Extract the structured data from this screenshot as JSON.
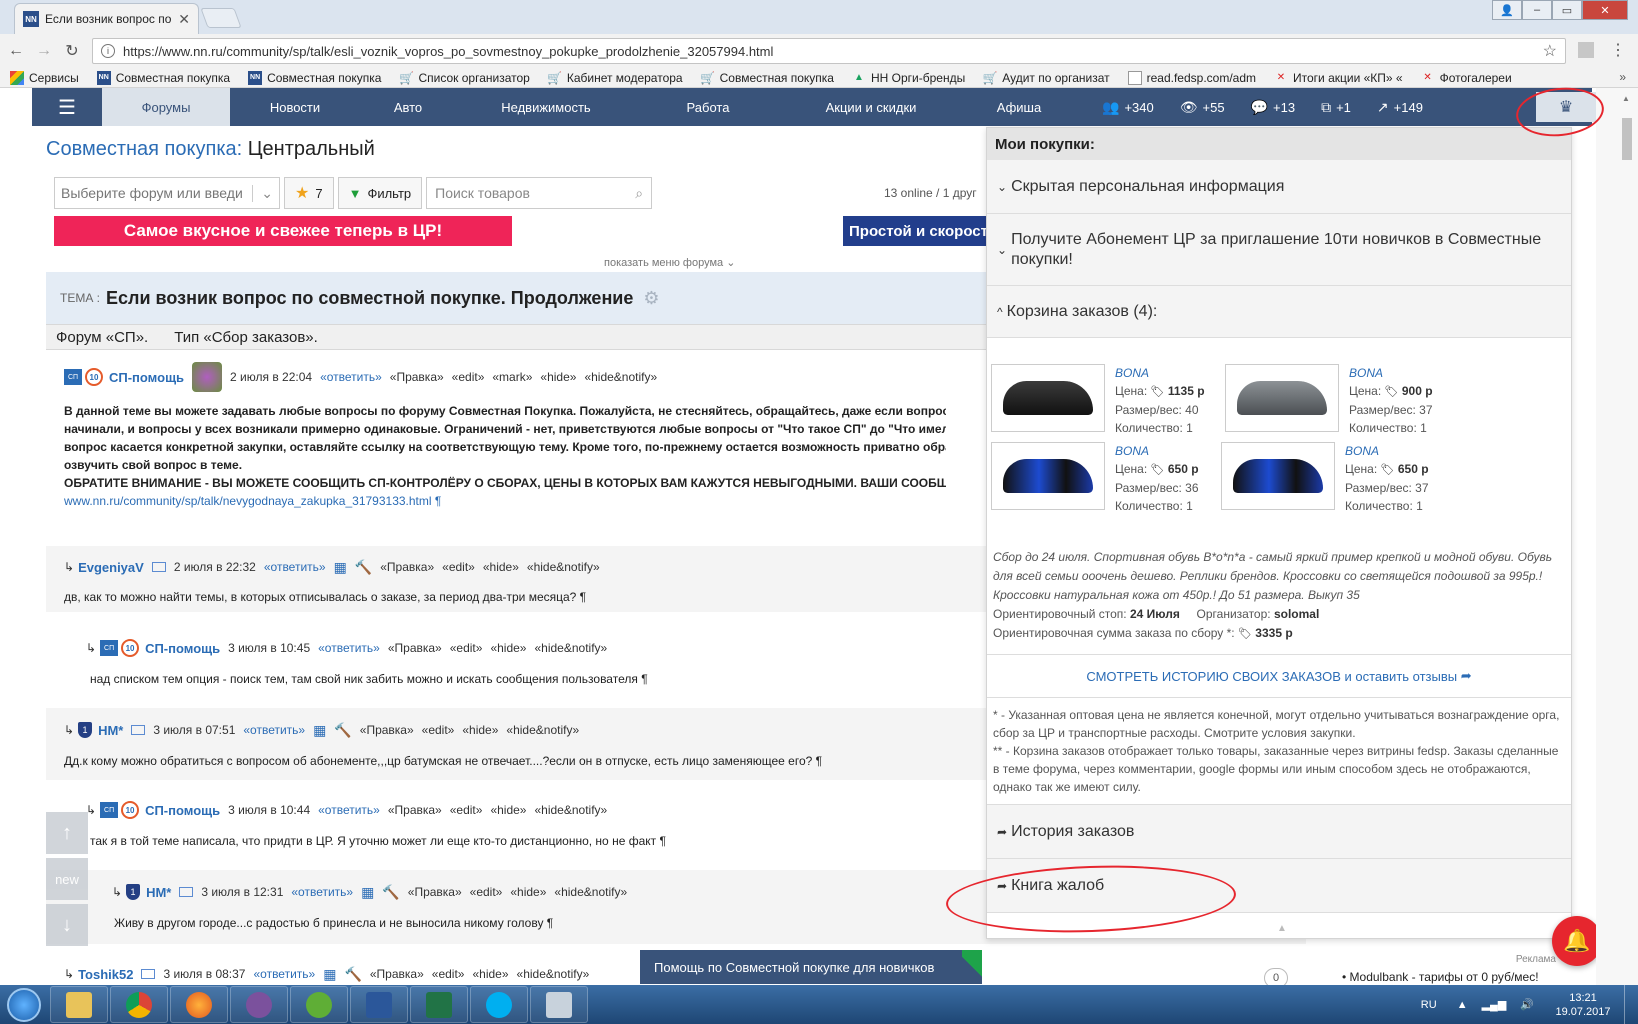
{
  "browser": {
    "tab_title": "Если возник вопрос по",
    "url": "https://www.nn.ru/community/sp/talk/esli_voznik_vopros_po_sovmestnoy_pokupke_prodolzhenie_32057994.html",
    "bookmarks": [
      {
        "label": "Сервисы",
        "icon": "apps"
      },
      {
        "label": "Совместная покупка",
        "icon": "nn"
      },
      {
        "label": "Совместная покупка",
        "icon": "nn"
      },
      {
        "label": "Список организатор",
        "icon": "cart"
      },
      {
        "label": "Кабинет модератора",
        "icon": "cart"
      },
      {
        "label": "Совместная покупка",
        "icon": "cart"
      },
      {
        "label": "НН Орги-бренды",
        "icon": "drive"
      },
      {
        "label": "Аудит по организат",
        "icon": "cart"
      },
      {
        "label": "read.fedsp.com/adm",
        "icon": "doc"
      },
      {
        "label": "Итоги акции «КП» «",
        "icon": "kp"
      },
      {
        "label": "Фотогалереи",
        "icon": "kp"
      }
    ]
  },
  "nav": {
    "items": [
      "Форумы",
      "Новости",
      "Авто",
      "Недвижимость",
      "Работа",
      "Акции и скидки",
      "Афиша"
    ],
    "stats": [
      {
        "icon": "users-icon",
        "glyph": "👥",
        "value": "+340"
      },
      {
        "icon": "eye-icon",
        "glyph": "👁",
        "value": "+55"
      },
      {
        "icon": "comment-icon",
        "glyph": "💬",
        "value": "+13"
      },
      {
        "icon": "windows-icon",
        "glyph": "⧉",
        "value": "+1"
      },
      {
        "icon": "rise-icon",
        "glyph": "↗",
        "value": "+149"
      }
    ]
  },
  "main": {
    "title_link": "Совместная покупка:",
    "title_rest": " Центральный",
    "forum_select_placeholder": "Выберите форум или введи",
    "fav_count": "7",
    "filter_label": "Фильтр",
    "search_placeholder": "Поиск товаров",
    "online": "13 online / 1 друг",
    "banner1": "Самое вкусное и свежее теперь в ЦР!",
    "banner2": "Простой и скоростной",
    "show_menu": "показать меню форума",
    "theme_label": "ТЕМА :",
    "theme_title": "Если возник вопрос по совместной покупке. Продолжение",
    "forum_name": "Форум «СП».",
    "forum_type": "Тип «Сбор заказов».",
    "help_bar": "Помощь по Совместной покупке для новичков",
    "side_new": "new",
    "zero": "0",
    "ad_label": "Реклама",
    "ad_text": "• Modulbank - тарифы от 0 руб/мес!"
  },
  "common": {
    "reply": "«ответить»",
    "edit_ru": "«Правка»",
    "edit": "«edit»",
    "mark": "«mark»",
    "hide": "«hide»",
    "hide_notify": "«hide&notify»",
    "sp_badge": "СП",
    "ten_badge": "10"
  },
  "posts": [
    {
      "author": "СП-помощь",
      "date": "2 июля в 22:04",
      "body": [
        "В данной теме вы можете задавать любые вопросы по форуму Совместная Покупка. Пожалуйста, не стесняйтесь, обращайтесь, даже если вопрос к",
        "начинали, и вопросы у всех возникали примерно одинаковые. Ограничений - нет, приветствуются любые вопросы от \"Что такое СП\" до \"Что имел в",
        "вопрос касается конкретной закупки, оставляйте ссылку на соответствующую тему. Кроме того, по-прежнему остается возможность приватно обрати",
        "озвучить свой вопрос в теме."
      ],
      "warning": "ОБРАТИТЕ ВНИМАНИЕ - ВЫ МОЖЕТЕ СООБЩИТЬ СП-КОНТРОЛЁРУ О СБОРАХ, ЦЕНЫ В КОТОРЫХ ВАМ КАЖУТСЯ НЕВЫГОДНЫМИ. ВАШИ СООБЩЕ",
      "link": "www.nn.ru/community/sp/talk/nevygodnaya_zakupka_31793133.html ¶"
    },
    {
      "author": "EvgeniyaV",
      "date": "2 июля в 22:32",
      "body": "дв, как то можно найти темы, в которых отписывалась о заказе, за период два-три месяца? ¶"
    },
    {
      "author": "СП-помощь",
      "date": "3 июля в 10:45",
      "body": "над списком тем опция - поиск тем, там свой ник забить можно и искать сообщения пользователя ¶"
    },
    {
      "author": "НМ*",
      "date": "3 июля в 07:51",
      "body": "Дд.к кому можно обратиться с вопросом об абонементе,,,цр батумская не отвечает....?если он в отпуске, есть лицо заменяющее его? ¶"
    },
    {
      "author": "СП-помощь",
      "date": "3 июля в 10:44",
      "body": "так я в той теме написала, что придти в ЦР. Я уточню может ли еще кто-то дистанционно, но не факт ¶"
    },
    {
      "author": "НМ*",
      "date": "3 июля в 12:31",
      "body": "Живу в другом городе...с радостью б принесла и не выносила никому голову ¶"
    },
    {
      "author": "Toshik52",
      "date": "3 июля в 08:37"
    }
  ],
  "panel": {
    "title": "Мои покупки:",
    "sec_hidden": "Скрытая персональная информация",
    "sec_abonement": "Получите Абонемент ЦР за приглашение 10ти новичков в Совместные покупки!",
    "sec_cart": "Корзина заказов (4):",
    "items": [
      {
        "brand": "BONA",
        "price": "1135 р",
        "size": "Размер/вес: 40",
        "qty": "Количество: 1"
      },
      {
        "brand": "BONA",
        "price": "900 р",
        "size": "Размер/вес: 37",
        "qty": "Количество: 1"
      },
      {
        "brand": "BONA",
        "price": "650 р",
        "size": "Размер/вес: 36",
        "qty": "Количество: 1"
      },
      {
        "brand": "BONA",
        "price": "650 р",
        "size": "Размер/вес: 37",
        "qty": "Количество: 1"
      }
    ],
    "price_label": "Цена:",
    "desc": "Сбор до 24 июля. Спортивная обувь B*o*n*a - самый яркий пример крепкой и модной обуви. Обувь для всей семьи ооочень дешево. Реплики брендов. Кроссовки со светящейся подошвой за 995р.! Кроссовки натуральная кожа от 450р.! До 51 размера. Выкуп 35",
    "stop_label": "Ориентировочный стоп:",
    "stop_value": "24 Июля",
    "org_label": "Организатор:",
    "org_value": "solomal",
    "sum_label": "Ориентировочная сумма заказа по сбору *:",
    "sum_value": "3335 р",
    "history_link": "СМОТРЕТЬ ИСТОРИЮ СВОИХ ЗАКАЗОВ и оставить отзывы",
    "note1": "* - Указанная оптовая цена не является конечной, могут отдельно учитываться вознаграждение орга, сбор за ЦР и транспортные расходы. Смотрите условия закупки.",
    "note2": "** - Корзина заказов отображает только товары, заказанные через витрины fedsp. Заказы сделанные в теме форума, через комментарии, google формы или иным способом здесь не отображаются, однако так же имеют силу.",
    "sec_history": "История заказов",
    "sec_complaints": "Книга жалоб"
  },
  "tray": {
    "lang": "RU",
    "time": "13:21",
    "date": "19.07.2017"
  }
}
